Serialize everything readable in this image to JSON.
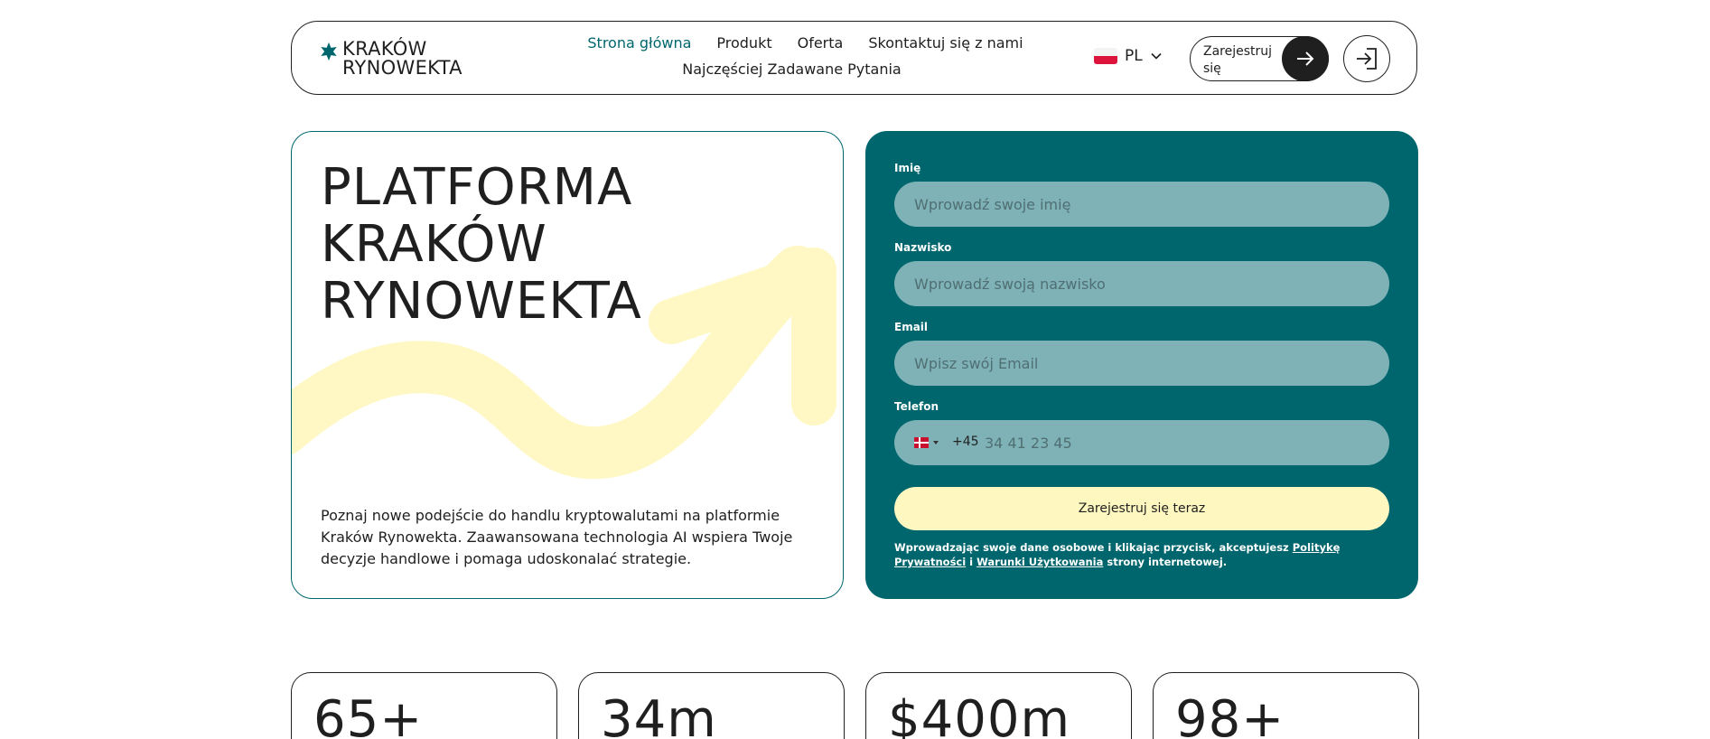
{
  "header": {
    "logo": {
      "line1": "KRAKÓW",
      "line2": "RYNOWEKTA"
    },
    "nav": [
      {
        "label": "Strona główna",
        "active": true
      },
      {
        "label": "Produkt"
      },
      {
        "label": "Oferta"
      },
      {
        "label": "Skontaktuj się z nami"
      },
      {
        "label": "Najczęściej Zadawane Pytania"
      }
    ],
    "language": {
      "code": "PL"
    },
    "register_label": "Zarejestruj się"
  },
  "hero": {
    "title": "PLATFORMA\nKRAKÓW\nRYNOWEKTA",
    "description": "Poznaj nowe podejście do handlu kryptowalutami na platformie Kraków Rynowekta. Zaawansowana technologia AI wspiera Twoje decyzje handlowe i pomaga udoskonalać strategie."
  },
  "form": {
    "first_name": {
      "label": "Imię",
      "placeholder": "Wprowadź swoje imię"
    },
    "last_name": {
      "label": "Nazwisko",
      "placeholder": "Wprowadź swoją nazwisko"
    },
    "email": {
      "label": "Email",
      "placeholder": "Wpisz swój Email"
    },
    "phone": {
      "label": "Telefon",
      "dial_code": "+45",
      "placeholder": "34 41 23 45"
    },
    "submit_label": "Zarejestruj się teraz",
    "consent": {
      "prefix": "Wprowadzając swoje dane osobowe i klikając przycisk, akceptujesz ",
      "privacy_link": "Politykę Prywatności",
      "middle": " i ",
      "terms_link": "Warunki Użytkowania",
      "suffix": " strony internetowej."
    }
  },
  "stats": [
    "65+",
    "34m",
    "$400m",
    "98+"
  ],
  "colors": {
    "brand_teal": "#00666e",
    "field_bg": "#7fb2b6",
    "accent_yellow": "#fff7c0",
    "dark": "#1f1f1f"
  }
}
